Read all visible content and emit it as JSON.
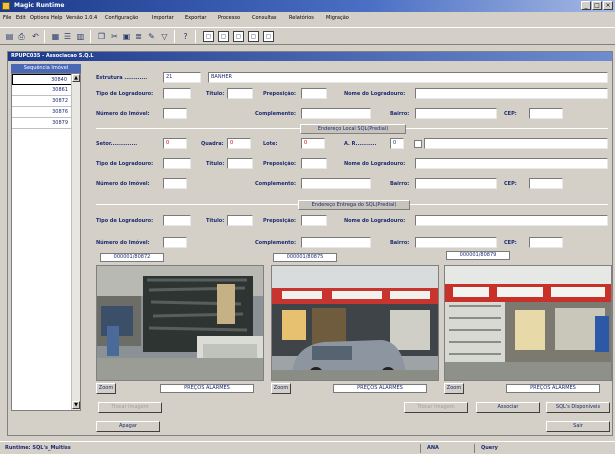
{
  "window": {
    "title": "Magic Runtime",
    "minimize": "_",
    "maximize": "□",
    "close": "×"
  },
  "menu": [
    "File",
    "Edit",
    "Options",
    "Help",
    "Versão 1.0.4",
    "Configuração",
    "Importar",
    "Exportar",
    "Processo",
    "Consultas",
    "Relatórios",
    "Migração"
  ],
  "toolbar_icons": [
    "open-icon",
    "print-icon",
    "undo-icon",
    "grid-icon",
    "list-icon",
    "table-icon",
    "copy-icon",
    "cut-icon",
    "paste-icon",
    "report-icon",
    "edit-icon",
    "filter-icon",
    "help-icon",
    "page-icon",
    "page-icon",
    "page-icon",
    "page-icon",
    "page-icon"
  ],
  "toolbar_glyphs": [
    "▤",
    "⎙",
    "↶",
    "▦",
    "☰",
    "▥",
    "❐",
    "✂",
    "▣",
    "≣",
    "✎",
    "▽",
    "?",
    "▢",
    "▢",
    "▢",
    "▢",
    "▢"
  ],
  "child_window": {
    "title": "RPUPC035 - Associacao S.Q.L"
  },
  "sequence": {
    "header": "Sequência Imóvel",
    "items": [
      "30840",
      "30861",
      "30872",
      "30876",
      "30879"
    ],
    "scroll_up": "▲",
    "scroll_down": "▼"
  },
  "form": {
    "estrutura_label": "Estrutura ............",
    "estrutura_code": "21",
    "estrutura_name": "BANHER",
    "address_labels": {
      "tipo": "Tipo de Logradouro:",
      "titulo": "Título:",
      "preposicao": "Preposição:",
      "nome": "Nome do Logradouro:",
      "numero": "Número do Imóvel:",
      "complemento": "Complemento:",
      "bairro": "Bairro:",
      "cep": "CEP:"
    },
    "section_local": "Endereço Local SQL(Predial)",
    "setor_label": "Setor..............",
    "setor_value": "0",
    "quadra_label": "Quadra:",
    "quadra_value": "0",
    "lote_label": "Lote:",
    "lote_value": "0",
    "ar_label": "A. R...........",
    "ar_value": "0",
    "section_entrega": "Endereço Entrega do SQL(Predial)"
  },
  "photos": [
    {
      "id": "000001/80872",
      "zoom": "Zoom",
      "caption": "PREÇOS ALARMES"
    },
    {
      "id": "000001/80875",
      "zoom": "Zoom",
      "caption": "PREÇOS ALARMES"
    },
    {
      "id": "000001/80879",
      "zoom": "Zoom",
      "caption": "PREÇOS ALARMES"
    }
  ],
  "buttons": {
    "trocar_imagem_left": "Trocar Imagem",
    "trocar_imagem_right": "Trocar Imagem",
    "associar": "Associar",
    "sql_disponivel": "SQL's Disponíveis",
    "apagar": "Apagar",
    "sair": "Sair"
  },
  "status": {
    "left": "Runtime: SQL's_Multiss",
    "ana": "ANA",
    "query": "Query"
  }
}
